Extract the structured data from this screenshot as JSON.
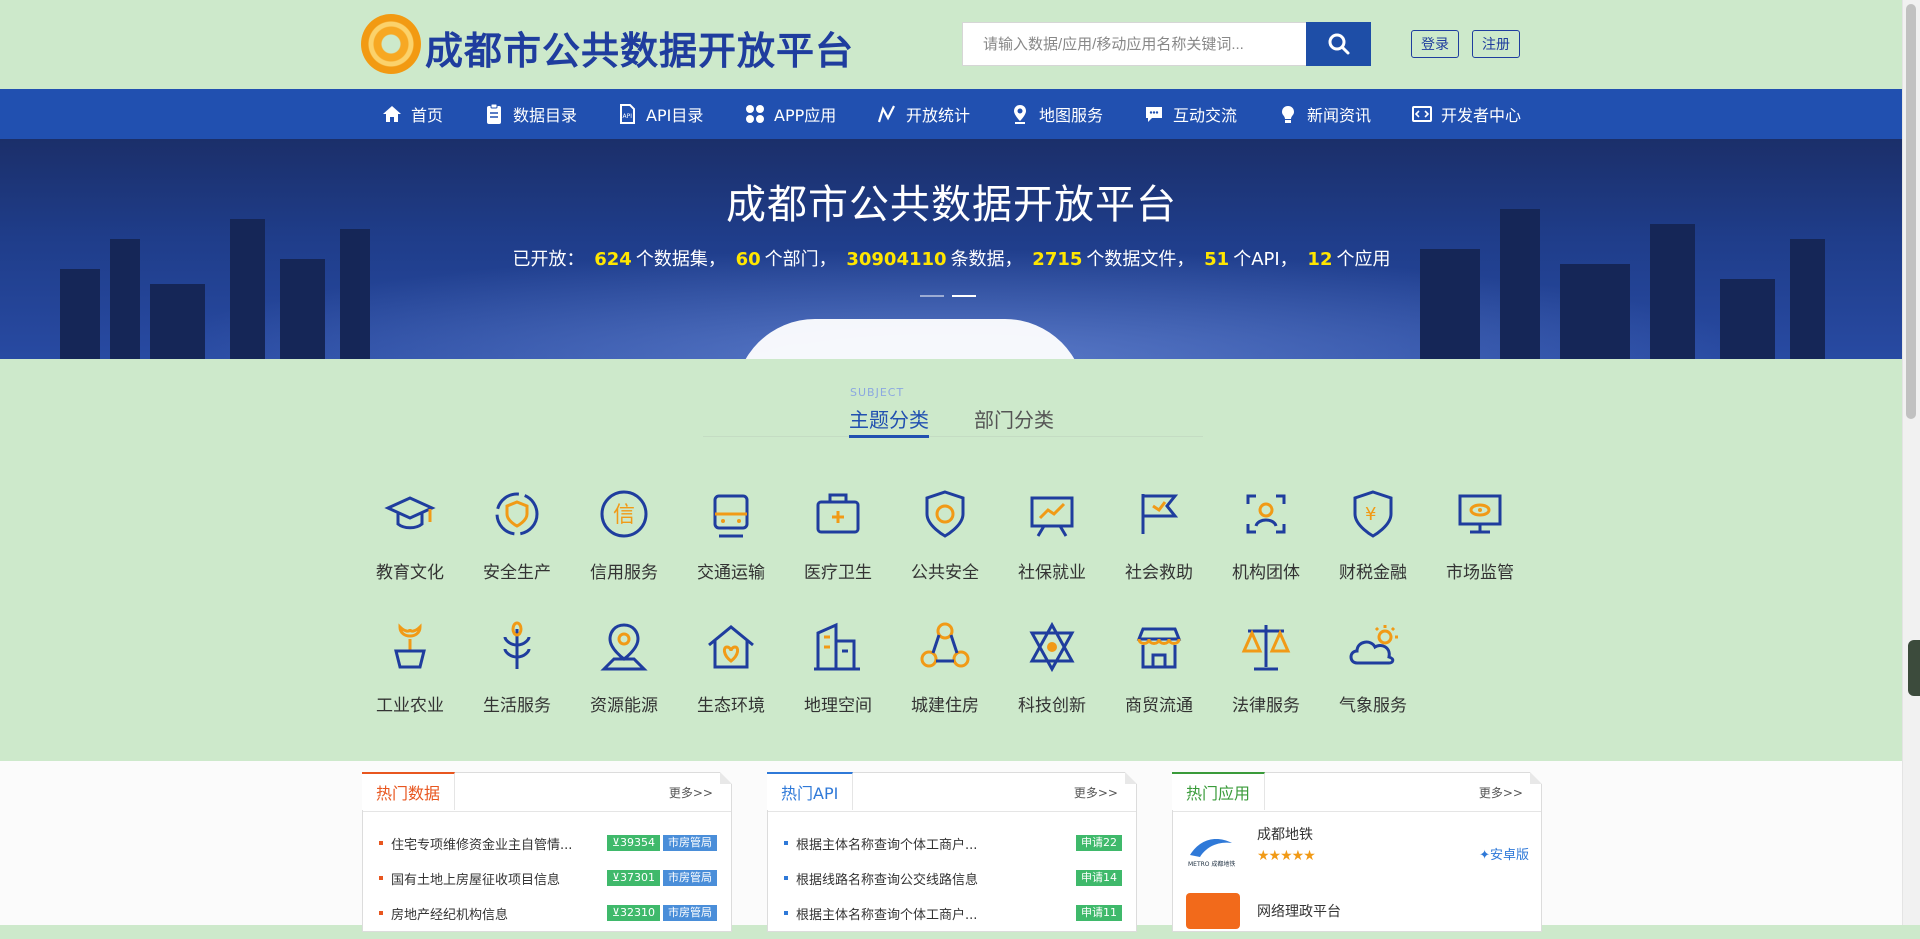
{
  "header": {
    "site_title": "成都市公共数据开放平台",
    "search_placeholder": "请输入数据/应用/移动应用名称关键词...",
    "login": "登录",
    "register": "注册"
  },
  "nav": [
    {
      "label": "首页",
      "icon": "home-icon"
    },
    {
      "label": "数据目录",
      "icon": "clipboard-icon"
    },
    {
      "label": "API目录",
      "icon": "api-file-icon"
    },
    {
      "label": "APP应用",
      "icon": "apps-grid-icon"
    },
    {
      "label": "开放统计",
      "icon": "chart-line-icon"
    },
    {
      "label": "地图服务",
      "icon": "map-pin-icon"
    },
    {
      "label": "互动交流",
      "icon": "chat-icon"
    },
    {
      "label": "新闻资讯",
      "icon": "news-icon"
    },
    {
      "label": "开发者中心",
      "icon": "code-icon"
    }
  ],
  "banner": {
    "title": "成都市公共数据开放平台",
    "prefix": "已开放：",
    "stats": [
      {
        "num": "624",
        "text": "个数据集，"
      },
      {
        "num": "60",
        "text": "个部门，"
      },
      {
        "num": "30904110",
        "text": "条数据，"
      },
      {
        "num": "2715",
        "text": "个数据文件，"
      },
      {
        "num": "51",
        "text": "个API，"
      },
      {
        "num": "12",
        "text": "个应用"
      }
    ]
  },
  "tabs": {
    "subtitle": "SUBJECT",
    "active": "主题分类",
    "inactive": "部门分类"
  },
  "categories": [
    "教育文化",
    "安全生产",
    "信用服务",
    "交通运输",
    "医疗卫生",
    "公共安全",
    "社保就业",
    "社会救助",
    "机构团体",
    "财税金融",
    "市场监管",
    "工业农业",
    "生活服务",
    "资源能源",
    "生态环境",
    "地理空间",
    "城建住房",
    "科技创新",
    "商贸流通",
    "法律服务",
    "气象服务"
  ],
  "panels": {
    "more": "更多>>",
    "hot_data": {
      "title": "热门数据",
      "rows": [
        {
          "text": "住宅专项维修资金业主自管情...",
          "count": "⊻39354",
          "dept": "市房管局"
        },
        {
          "text": "国有土地上房屋征收项目信息",
          "count": "⊻37301",
          "dept": "市房管局"
        },
        {
          "text": "房地产经纪机构信息",
          "count": "⊻32310",
          "dept": "市房管局"
        }
      ]
    },
    "hot_api": {
      "title": "热门API",
      "rows": [
        {
          "text": "根据主体名称查询个体工商户...",
          "count": "申请22"
        },
        {
          "text": "根据线路名称查询公交线路信息",
          "count": "申请14"
        },
        {
          "text": "根据主体名称查询个体工商户...",
          "count": "申请11"
        }
      ]
    },
    "hot_apps": {
      "title": "热门应用",
      "apps": [
        {
          "name": "成都地铁",
          "rating": 5,
          "stars": "★★★★★",
          "platform": "安卓版",
          "logo_text": "METRO 成都地铁"
        },
        {
          "name": "网络理政平台"
        }
      ]
    }
  },
  "colors": {
    "brand_blue": "#2150b0",
    "page_bg": "#cde9cb",
    "stat_yellow": "#ffe600",
    "icon_orange": "#f19a16",
    "hot_data_accent": "#e8561f",
    "hot_api_accent": "#2f79d8",
    "hot_app_accent": "#3a9b3a",
    "count_badge_green": "#3fb96b",
    "dept_badge_blue": "#4a8ed9"
  }
}
